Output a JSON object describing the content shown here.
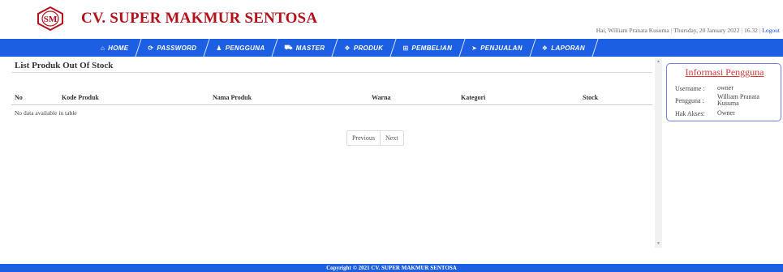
{
  "header": {
    "company_name": "CV. SUPER MAKMUR SENTOSA",
    "logo_text": "SM",
    "greeting": "Hai, William Pranata Kusuma",
    "date": "Thursday, 20 January 2022",
    "time": "16.32",
    "logout": "Logout",
    "brand_color": "#b3121d"
  },
  "nav": {
    "color": "#1d5fe3",
    "items": [
      {
        "label": "HOME",
        "icon": "home-icon",
        "glyph": "⌂"
      },
      {
        "label": "PASSWORD",
        "icon": "refresh-icon",
        "glyph": "⟳"
      },
      {
        "label": "PENGGUNA",
        "icon": "user-icon",
        "glyph": "♟"
      },
      {
        "label": "MASTER",
        "icon": "car-icon",
        "glyph": "⛟"
      },
      {
        "label": "PRODUK",
        "icon": "cubes-icon",
        "glyph": "❖"
      },
      {
        "label": "PEMBELIAN",
        "icon": "cart-icon",
        "glyph": "⊞"
      },
      {
        "label": "PENJUALAN",
        "icon": "tag-icon",
        "glyph": "➤"
      },
      {
        "label": "LAPORAN",
        "icon": "report-icon",
        "glyph": "❖"
      }
    ]
  },
  "main": {
    "title": "List Produk Out Of Stock",
    "columns": [
      "No",
      "Kode Produk",
      "Nama Produk",
      "Warna",
      "Kategori",
      "Stock"
    ],
    "empty_message": "No data available in table",
    "pager": {
      "previous": "Previous",
      "next": "Next"
    }
  },
  "info": {
    "title": "Informasi Pengguna",
    "username_label": "Username",
    "username": "owner",
    "pengguna_label": "Pengguna",
    "pengguna": "William Pranata Kusuma",
    "akses_label": "Hak Akses",
    "akses": "Owner"
  },
  "footer": {
    "text": "Copyright © 2021 CV. SUPER MAKMUR SENTOSA"
  }
}
